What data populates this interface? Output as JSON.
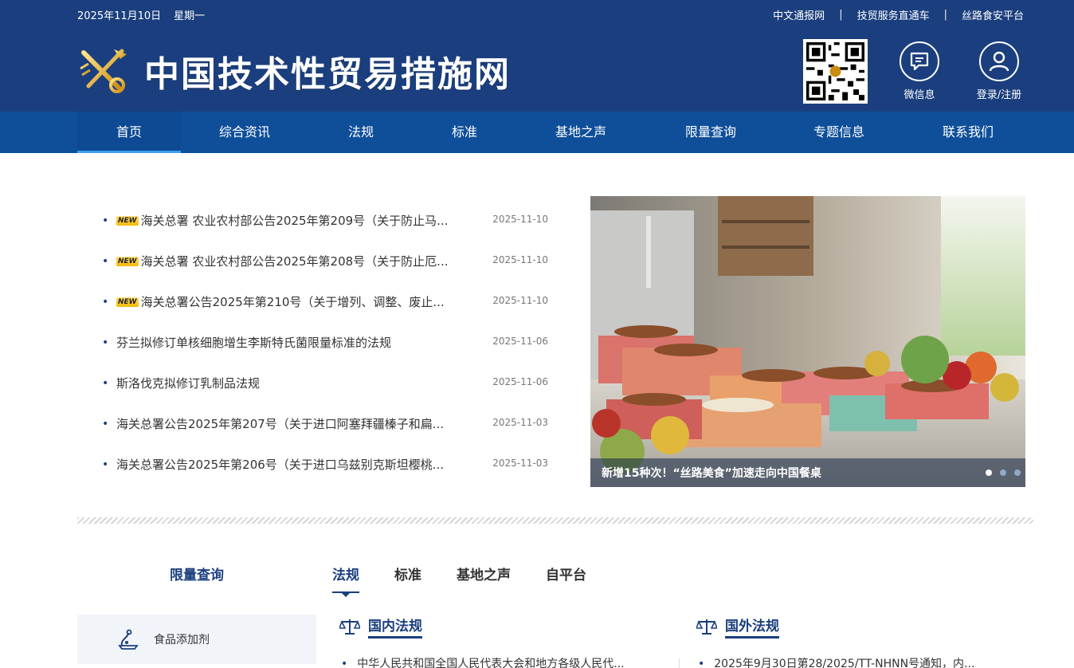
{
  "top": {
    "date": "2025年11月10日",
    "weekday": "星期一",
    "links": [
      "中文通报网",
      "技贸服务直通车",
      "丝路食安平台"
    ],
    "separator": "|"
  },
  "brand": {
    "title": "中国技术性贸易措施网"
  },
  "header_buttons": {
    "wechat": "微信息",
    "login": "登录/注册"
  },
  "nav": [
    "首页",
    "综合资讯",
    "法规",
    "标准",
    "基地之声",
    "限量查询",
    "专题信息",
    "联系我们"
  ],
  "news": [
    {
      "is_new": true,
      "badge": "NEW",
      "title": "海关总署 农业农村部公告2025年第209号（关于防止马...",
      "date": "2025-11-10"
    },
    {
      "is_new": true,
      "badge": "NEW",
      "title": "海关总署 农业农村部公告2025年第208号（关于防止厄...",
      "date": "2025-11-10"
    },
    {
      "is_new": true,
      "badge": "NEW",
      "title": "海关总署公告2025年第210号（关于增列、调整、废止...",
      "date": "2025-11-10"
    },
    {
      "is_new": false,
      "badge": "",
      "title": "芬兰拟修订单核细胞增生李斯特氏菌限量标准的法规",
      "date": "2025-11-06"
    },
    {
      "is_new": false,
      "badge": "",
      "title": "斯洛伐克拟修订乳制品法规",
      "date": "2025-11-06"
    },
    {
      "is_new": false,
      "badge": "",
      "title": "海关总署公告2025年第207号（关于进口阿塞拜疆榛子和扁...",
      "date": "2025-11-03"
    },
    {
      "is_new": false,
      "badge": "",
      "title": "海关总署公告2025年第206号（关于进口乌兹别克斯坦樱桃...",
      "date": "2025-11-03"
    }
  ],
  "slide": {
    "caption": "新增15种次！“丝路美食”加速走向中国餐桌",
    "dots": 3,
    "active_dot": 0
  },
  "bullet": "•",
  "bottom": {
    "limit_title": "限量查询",
    "tabs": [
      "法规",
      "标准",
      "基地之声",
      "自平台"
    ],
    "active_tab": 0,
    "side_item": "食品添加剂",
    "domestic_title": "国内法规",
    "foreign_title": "国外法规",
    "domestic_first": "中华人民共和国全国人民代表大会和地方各级人民代...",
    "foreign_first": "2025年9月30日第28/2025/TT-NHNN号通知，内..."
  },
  "colors": {
    "header": "#1b3f7e",
    "nav": "#0f4f9a",
    "accent": "#3c9ef0"
  }
}
